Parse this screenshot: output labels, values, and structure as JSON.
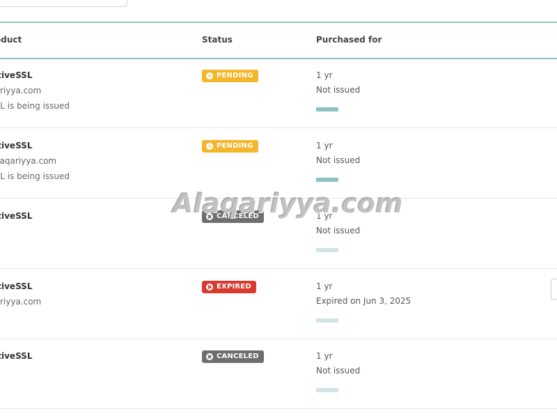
{
  "header": {
    "product": "oduct",
    "status": "Status",
    "purchased_for": "Purchased for"
  },
  "rows": [
    {
      "name": "sitiveSSL",
      "domain": "qariyya.com",
      "note": "SSL is being issued",
      "status": "PENDING",
      "status_type": "pending",
      "term": "1 yr",
      "issue": "Not issued",
      "bar": "dark"
    },
    {
      "name": "sitiveSSL",
      "domain": ".alaqariyya.com",
      "note": "SSL is being issued",
      "status": "PENDING",
      "status_type": "pending",
      "term": "1 yr",
      "issue": "Not issued",
      "bar": "dark"
    },
    {
      "name": "sitiveSSL",
      "domain": "",
      "note": "",
      "status": "CANCELED",
      "status_type": "canceled",
      "term": "1 yr",
      "issue": "Not issued",
      "bar": "light"
    },
    {
      "name": "sitiveSSL",
      "domain": "qariyya.com",
      "note": "",
      "status": "EXPIRED",
      "status_type": "expired",
      "term": "1 yr",
      "issue": "Expired on Jun 3, 2025",
      "bar": "light"
    },
    {
      "name": "sitiveSSL",
      "domain": "",
      "note": "",
      "status": "CANCELED",
      "status_type": "canceled",
      "term": "1 yr",
      "issue": "Not issued",
      "bar": "light"
    }
  ],
  "watermark": "Alaqariyya.com",
  "icons": {
    "pending": "clock-icon",
    "canceled": "x-icon",
    "expired": "x-icon"
  },
  "colors": {
    "pending": "#f4b62b",
    "canceled": "#6e6e6e",
    "expired": "#d83a2e",
    "accent": "#8fc3c3"
  }
}
